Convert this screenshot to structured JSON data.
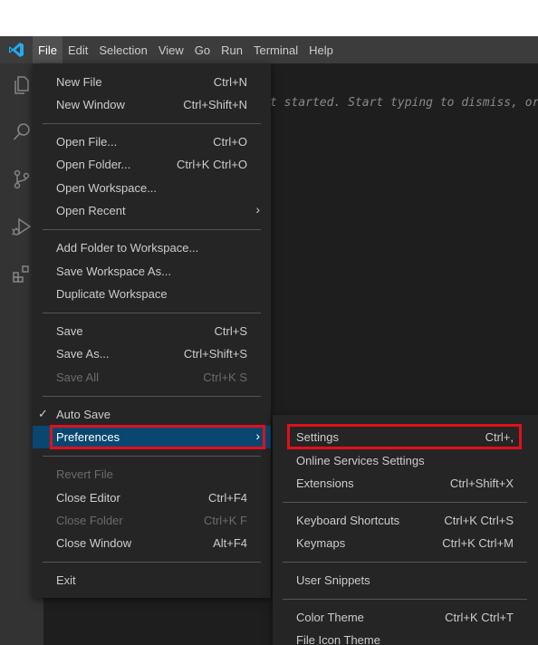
{
  "menubar": {
    "logo_icon": "vscode-logo-icon",
    "items": [
      "File",
      "Edit",
      "Selection",
      "View",
      "Go",
      "Run",
      "Terminal",
      "Help"
    ]
  },
  "activitybar": {
    "icons": [
      "explorer-icon",
      "search-icon",
      "source-control-icon",
      "run-debug-icon",
      "extensions-icon"
    ]
  },
  "editor": {
    "hint": "t started. Start typing to dismiss, or"
  },
  "file_menu": {
    "new_file": {
      "label": "New File",
      "kb": "Ctrl+N"
    },
    "new_window": {
      "label": "New Window",
      "kb": "Ctrl+Shift+N"
    },
    "open_file": {
      "label": "Open File...",
      "kb": "Ctrl+O"
    },
    "open_folder": {
      "label": "Open Folder...",
      "kb": "Ctrl+K Ctrl+O"
    },
    "open_workspace": {
      "label": "Open Workspace...",
      "kb": ""
    },
    "open_recent": {
      "label": "Open Recent",
      "kb": ""
    },
    "add_folder": {
      "label": "Add Folder to Workspace...",
      "kb": ""
    },
    "save_workspace_as": {
      "label": "Save Workspace As...",
      "kb": ""
    },
    "duplicate_workspace": {
      "label": "Duplicate Workspace",
      "kb": ""
    },
    "save": {
      "label": "Save",
      "kb": "Ctrl+S"
    },
    "save_as": {
      "label": "Save As...",
      "kb": "Ctrl+Shift+S"
    },
    "save_all": {
      "label": "Save All",
      "kb": "Ctrl+K S"
    },
    "auto_save": {
      "label": "Auto Save",
      "kb": "",
      "checked": true
    },
    "preferences": {
      "label": "Preferences",
      "kb": ""
    },
    "revert_file": {
      "label": "Revert File",
      "kb": ""
    },
    "close_editor": {
      "label": "Close Editor",
      "kb": "Ctrl+F4"
    },
    "close_folder": {
      "label": "Close Folder",
      "kb": "Ctrl+K F"
    },
    "close_window": {
      "label": "Close Window",
      "kb": "Alt+F4"
    },
    "exit": {
      "label": "Exit",
      "kb": ""
    }
  },
  "preferences_menu": {
    "settings": {
      "label": "Settings",
      "kb": "Ctrl+,"
    },
    "online_services": {
      "label": "Online Services Settings",
      "kb": ""
    },
    "extensions": {
      "label": "Extensions",
      "kb": "Ctrl+Shift+X"
    },
    "keyboard_shortcuts": {
      "label": "Keyboard Shortcuts",
      "kb": "Ctrl+K Ctrl+S"
    },
    "keymaps": {
      "label": "Keymaps",
      "kb": "Ctrl+K Ctrl+M"
    },
    "user_snippets": {
      "label": "User Snippets",
      "kb": ""
    },
    "color_theme": {
      "label": "Color Theme",
      "kb": "Ctrl+K Ctrl+T"
    },
    "file_icon_theme": {
      "label": "File Icon Theme",
      "kb": ""
    }
  },
  "colors": {
    "selection": "#094771",
    "highlight": "#e0101c",
    "vscode_blue": "#23a9f2"
  }
}
